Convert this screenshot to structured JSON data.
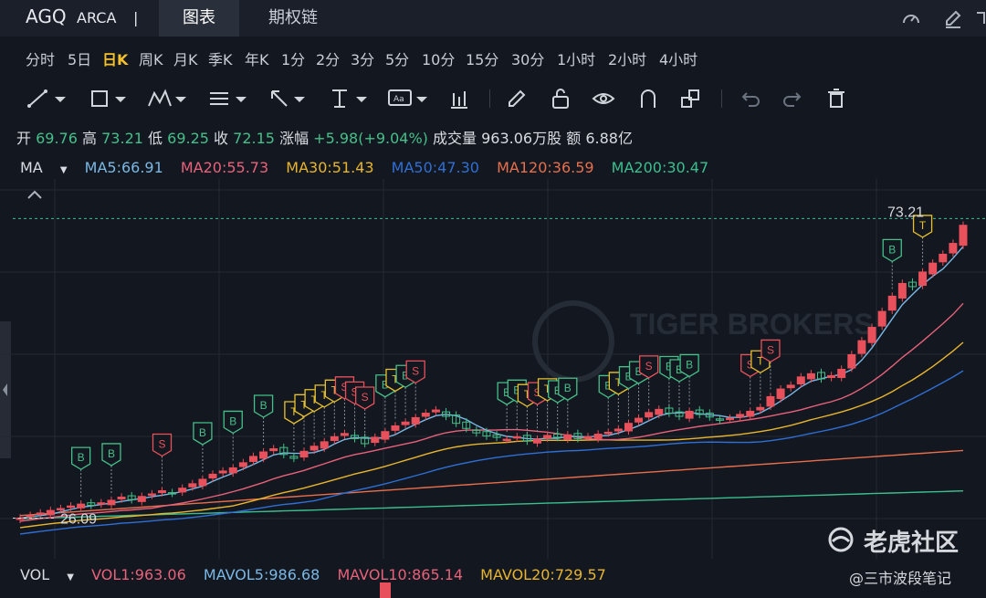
{
  "header": {
    "symbol": "AGQ",
    "exchange": "ARCA",
    "separator": "|",
    "tabs": [
      {
        "label": "图表",
        "active": true
      },
      {
        "label": "期权链",
        "active": false
      }
    ],
    "right_icons": [
      "gauge-icon",
      "edit-icon",
      "fullscreen-icon"
    ]
  },
  "periods": [
    "分时",
    "5日",
    "日K",
    "周K",
    "月K",
    "季K",
    "年K",
    "1分",
    "2分",
    "3分",
    "5分",
    "10分",
    "15分",
    "30分",
    "1小时",
    "2小时",
    "4小时"
  ],
  "active_period": "日K",
  "toolbar_icons": [
    "line-tool-icon",
    "rectangle-tool-icon",
    "pattern-tool-icon",
    "fib-tool-icon",
    "arrow-tool-icon",
    "text-anchor-tool-icon",
    "label-tool-icon",
    "bar-stats-icon",
    "pen-icon",
    "lock-icon",
    "eye-icon",
    "magnet-icon",
    "layers-icon",
    "undo-icon",
    "redo-icon",
    "delete-icon"
  ],
  "quote": {
    "open_label": "开",
    "open": "69.76",
    "high_label": "高",
    "high": "73.21",
    "low_label": "低",
    "low": "69.25",
    "close_label": "收",
    "close": "72.15",
    "change_label": "涨幅",
    "change": "+5.98(+9.04%)",
    "volume_label": "成交量",
    "volume": "963.06万股",
    "amount_label": "额",
    "amount": "6.88亿"
  },
  "ma": {
    "label": "MA",
    "items": [
      {
        "text": "MA5:66.91",
        "color": "#7ab8e6"
      },
      {
        "text": "MA20:55.73",
        "color": "#e8627b"
      },
      {
        "text": "MA30:51.43",
        "color": "#e8b52e"
      },
      {
        "text": "MA50:47.30",
        "color": "#2f6fd6"
      },
      {
        "text": "MA120:36.59",
        "color": "#e86f4d"
      },
      {
        "text": "MA200:30.47",
        "color": "#3cbf8f"
      }
    ]
  },
  "chart_labels": {
    "high_marker": "73.21",
    "low_marker": "26.09",
    "watermark": "TIGER BROKERS"
  },
  "volume": {
    "label": "VOL",
    "items": [
      {
        "text": "VOL1:963.06",
        "color": "#e8627b"
      },
      {
        "text": "MAVOL5:986.68",
        "color": "#7ab8e6"
      },
      {
        "text": "MAVOL10:865.14",
        "color": "#e8627b"
      },
      {
        "text": "MAVOL20:729.57",
        "color": "#e8b52e"
      }
    ]
  },
  "watermark": {
    "brand": "老虎社区",
    "author": "@三市波段笔记"
  },
  "chart_data": {
    "type": "candlestick",
    "ylim": [
      22,
      78
    ],
    "up_color": "#e8505b",
    "down_color": "#45c08a",
    "closes": [
      26.1,
      26.5,
      26.9,
      27.3,
      27.6,
      28.0,
      28.3,
      28.1,
      28.5,
      28.9,
      29.4,
      29.0,
      29.5,
      29.9,
      30.4,
      30.0,
      30.8,
      31.5,
      32.2,
      33.0,
      33.5,
      34.0,
      34.8,
      35.8,
      36.5,
      37.0,
      36.1,
      35.5,
      36.6,
      37.4,
      38.1,
      38.9,
      39.4,
      38.6,
      37.8,
      38.8,
      39.7,
      40.6,
      41.2,
      41.9,
      42.6,
      43.1,
      42.1,
      41.0,
      40.2,
      39.5,
      39.0,
      38.8,
      38.5,
      38.9,
      38.2,
      38.5,
      39.1,
      38.8,
      39.2,
      38.6,
      38.9,
      39.3,
      39.6,
      40.1,
      41.0,
      41.8,
      42.7,
      43.2,
      42.6,
      42.1,
      42.9,
      42.4,
      42.0,
      41.5,
      41.8,
      42.4,
      42.9,
      43.5,
      45.2,
      46.4,
      47.0,
      48.3,
      48.8,
      48.0,
      48.5,
      49.5,
      51.8,
      54.0,
      56.1,
      58.6,
      61.0,
      63.0,
      62.5,
      64.8,
      66.2,
      67.6,
      69.3,
      72.15
    ],
    "markers": [
      {
        "i": 6,
        "type": "B",
        "color": "#45c08a"
      },
      {
        "i": 9,
        "type": "B",
        "color": "#45c08a"
      },
      {
        "i": 14,
        "type": "S",
        "color": "#e8505b"
      },
      {
        "i": 18,
        "type": "B",
        "color": "#45c08a"
      },
      {
        "i": 21,
        "type": "B",
        "color": "#45c08a"
      },
      {
        "i": 24,
        "type": "B",
        "color": "#45c08a"
      },
      {
        "i": 27,
        "type": "T",
        "color": "#e8c22e"
      },
      {
        "i": 28,
        "type": "T",
        "color": "#e8c22e"
      },
      {
        "i": 29,
        "type": "T",
        "color": "#e8c22e"
      },
      {
        "i": 30,
        "type": "T",
        "color": "#e8c22e"
      },
      {
        "i": 31,
        "type": "T",
        "color": "#e8c22e"
      },
      {
        "i": 32,
        "type": "S",
        "color": "#e8505b"
      },
      {
        "i": 33,
        "type": "S",
        "color": "#e8505b"
      },
      {
        "i": 34,
        "type": "S",
        "color": "#e8505b"
      },
      {
        "i": 36,
        "type": "B",
        "color": "#45c08a"
      },
      {
        "i": 37,
        "type": "T",
        "color": "#e8c22e"
      },
      {
        "i": 38,
        "type": "B",
        "color": "#45c08a"
      },
      {
        "i": 39,
        "type": "S",
        "color": "#e8505b"
      },
      {
        "i": 48,
        "type": "B",
        "color": "#45c08a"
      },
      {
        "i": 49,
        "type": "B",
        "color": "#45c08a"
      },
      {
        "i": 50,
        "type": "T",
        "color": "#e8c22e"
      },
      {
        "i": 51,
        "type": "S",
        "color": "#e8505b"
      },
      {
        "i": 52,
        "type": "T",
        "color": "#e8c22e"
      },
      {
        "i": 53,
        "type": "B",
        "color": "#45c08a"
      },
      {
        "i": 54,
        "type": "B",
        "color": "#45c08a"
      },
      {
        "i": 58,
        "type": "B",
        "color": "#45c08a"
      },
      {
        "i": 59,
        "type": "T",
        "color": "#e8c22e"
      },
      {
        "i": 60,
        "type": "B",
        "color": "#45c08a"
      },
      {
        "i": 61,
        "type": "B",
        "color": "#45c08a"
      },
      {
        "i": 62,
        "type": "S",
        "color": "#e8505b"
      },
      {
        "i": 64,
        "type": "B",
        "color": "#45c08a"
      },
      {
        "i": 65,
        "type": "B",
        "color": "#45c08a"
      },
      {
        "i": 66,
        "type": "B",
        "color": "#45c08a"
      },
      {
        "i": 72,
        "type": "S",
        "color": "#e8505b"
      },
      {
        "i": 73,
        "type": "T",
        "color": "#e8c22e"
      },
      {
        "i": 74,
        "type": "S",
        "color": "#e8505b"
      },
      {
        "i": 86,
        "type": "B",
        "color": "#45c08a"
      },
      {
        "i": 89,
        "type": "T",
        "color": "#e8c22e"
      }
    ]
  }
}
